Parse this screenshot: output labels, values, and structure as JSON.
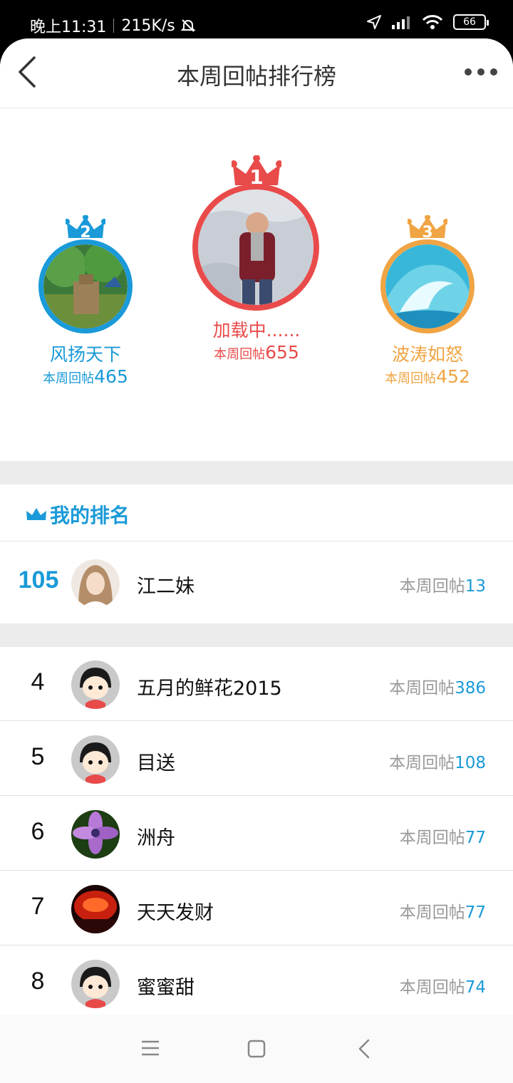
{
  "status": {
    "time": "晚上11:31",
    "speed": "215K/s",
    "battery": "66"
  },
  "header": {
    "title": "本周回帖排行榜"
  },
  "podium": [
    {
      "rank": "1",
      "name": "加载中......",
      "label": "本周回帖",
      "count": "655",
      "color": "#e94b4b"
    },
    {
      "rank": "2",
      "name": "风扬天下",
      "label": "本周回帖",
      "count": "465",
      "color": "#1a9ad8"
    },
    {
      "rank": "3",
      "name": "波涛如怒",
      "label": "本周回帖",
      "count": "452",
      "color": "#f0a443"
    }
  ],
  "my_rank": {
    "title": "我的排名",
    "rank": "105",
    "name": "江二妹",
    "label": "本周回帖",
    "count": "13"
  },
  "list": [
    {
      "rank": "4",
      "name": "五月的鲜花2015",
      "label": "本周回帖",
      "count": "386",
      "avatar": "cartoon"
    },
    {
      "rank": "5",
      "name": "目送",
      "label": "本周回帖",
      "count": "108",
      "avatar": "cartoon"
    },
    {
      "rank": "6",
      "name": "洲舟",
      "label": "本周回帖",
      "count": "77",
      "avatar": "flower"
    },
    {
      "rank": "7",
      "name": "天天发财",
      "label": "本周回帖",
      "count": "77",
      "avatar": "red"
    },
    {
      "rank": "8",
      "name": "蜜蜜甜",
      "label": "本周回帖",
      "count": "74",
      "avatar": "cartoon"
    }
  ]
}
